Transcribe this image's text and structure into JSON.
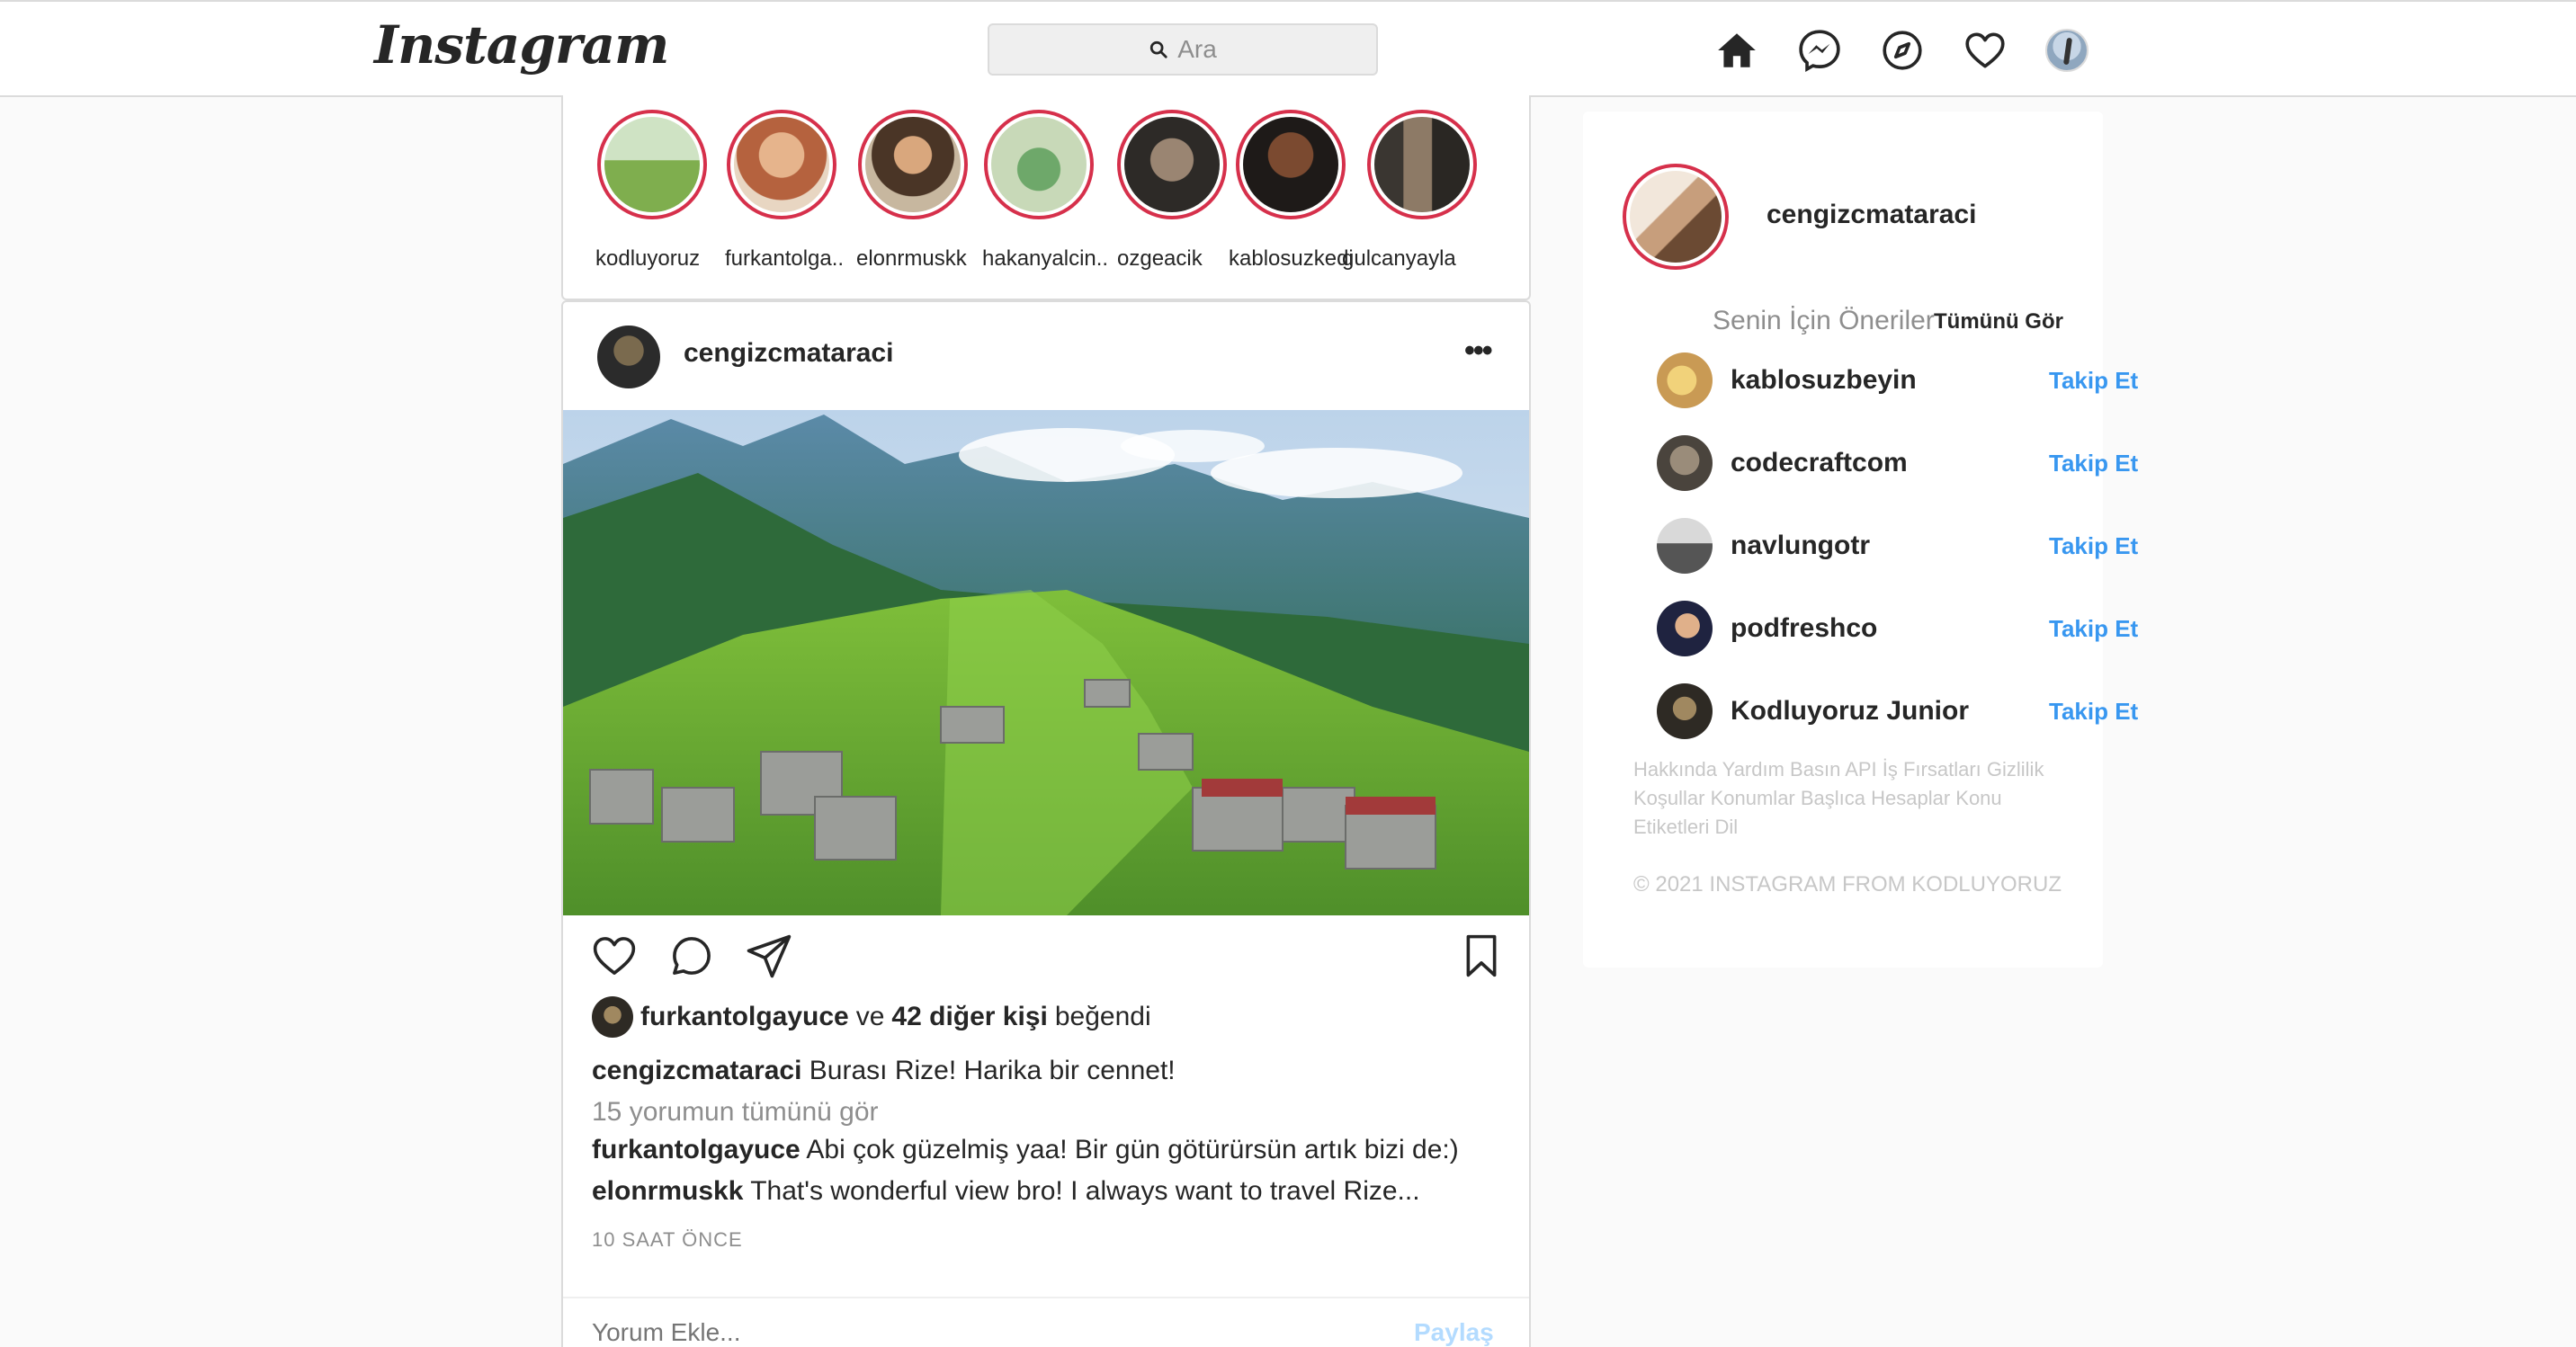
{
  "header": {
    "logo": "Instagram",
    "search_placeholder": "Ara",
    "icons": [
      "home-icon",
      "messenger-icon",
      "explore-icon",
      "heart-icon",
      "profile-avatar"
    ]
  },
  "stories": [
    {
      "username": "kodluyoruz"
    },
    {
      "username": "furkantolga.."
    },
    {
      "username": "elonrmuskk"
    },
    {
      "username": "hakanyalcin.."
    },
    {
      "username": "ozgeacik"
    },
    {
      "username": "kablosuzkedi"
    },
    {
      "username": "gulcanyayla"
    }
  ],
  "post": {
    "username": "cengizcmataraci",
    "more": "•••",
    "liked_by_user": "furkantolgayuce",
    "liked_ve": "ve",
    "liked_others": "42 diğer kişi",
    "liked_suffix": "beğendi",
    "caption_user": "cengizcmataraci",
    "caption_text": "Burası Rize! Harika bir cennet!",
    "view_all_comments": "15 yorumun tümünü gör",
    "comments": [
      {
        "user": "furkantolgayuce",
        "text": "Abi çok güzelmiş yaa! Bir gün götürürsün artık bizi de:)"
      },
      {
        "user": "elonrmuskk",
        "text": "That's wonderful view bro! I always want to travel Rize..."
      }
    ],
    "time": "10 SAAT ÖNCE",
    "add_comment_placeholder": "Yorum Ekle...",
    "share_button": "Paylaş"
  },
  "sidebar": {
    "me": "cengizcmataraci",
    "suggestions_title": "Senin İçin Öneriler",
    "see_all": "Tümünü Gör",
    "follow_label": "Takip Et",
    "suggestions": [
      {
        "username": "kablosuzbeyin"
      },
      {
        "username": "codecraftcom"
      },
      {
        "username": "navlungotr"
      },
      {
        "username": "podfreshco"
      },
      {
        "username": "Kodluyoruz Junior"
      }
    ],
    "footer_links": "Hakkında Yardım Basın API İş Fırsatları Gizlilik Koşullar Konumlar Başlıca Hesaplar Konu Etiketleri Dil",
    "copyright": "© 2021 INSTAGRAM FROM KODLUYORUZ"
  },
  "colors": {
    "story_ring": "#d6304b",
    "link_blue": "#3897f0",
    "muted": "#8e8e8e"
  }
}
